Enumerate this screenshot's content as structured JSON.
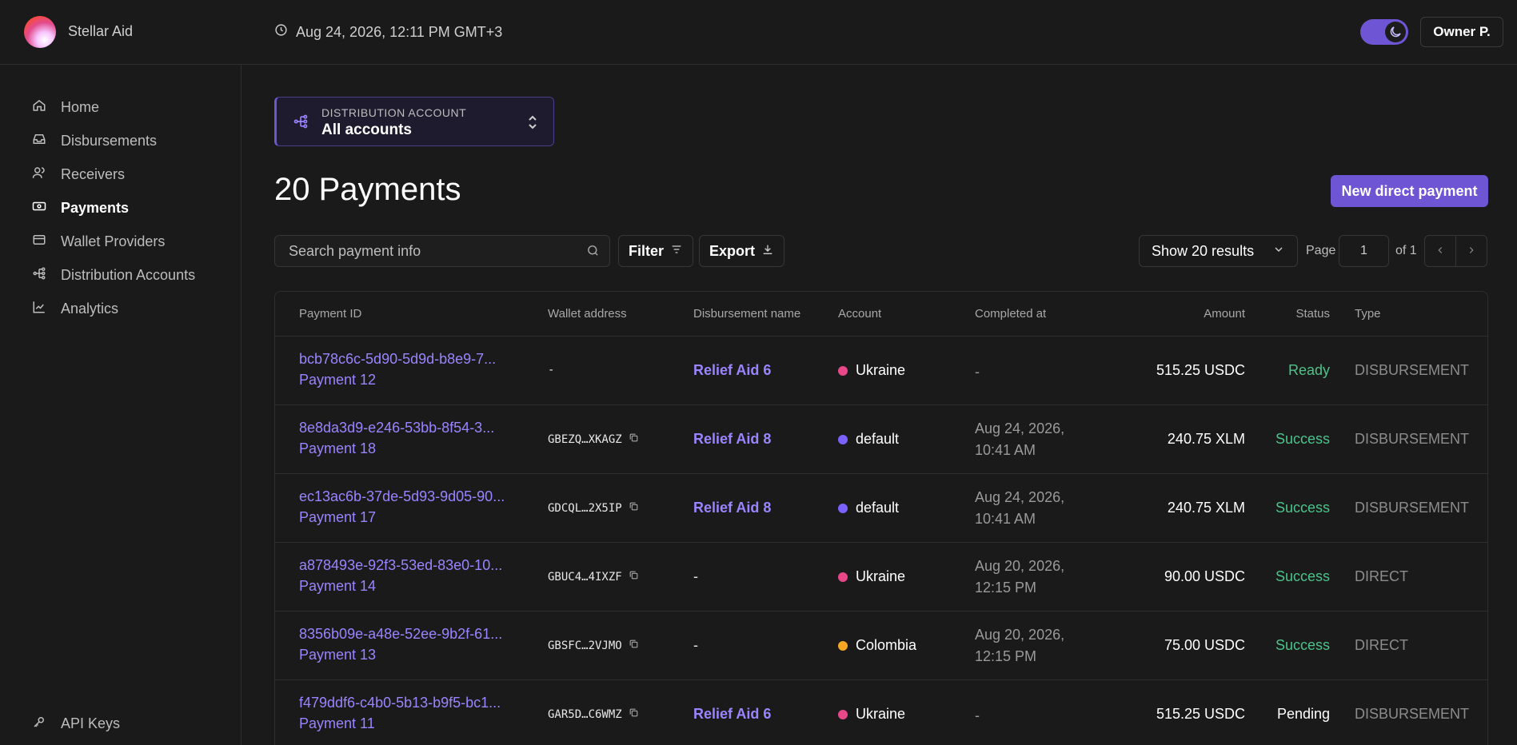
{
  "app": {
    "name": "Stellar Aid"
  },
  "header": {
    "datetime": "Aug 24, 2026, 12:11 PM GMT+3",
    "user_label": "Owner P.",
    "theme_toggle": "dark"
  },
  "sidebar": {
    "items": [
      {
        "label": "Home",
        "icon": "home-icon"
      },
      {
        "label": "Disbursements",
        "icon": "inbox-icon"
      },
      {
        "label": "Receivers",
        "icon": "users-icon"
      },
      {
        "label": "Payments",
        "icon": "banknote-icon",
        "active": true
      },
      {
        "label": "Wallet Providers",
        "icon": "wallet-icon"
      },
      {
        "label": "Distribution Accounts",
        "icon": "network-icon"
      },
      {
        "label": "Analytics",
        "icon": "chart-line-icon"
      }
    ],
    "footer_item": {
      "label": "API Keys",
      "icon": "key-icon"
    }
  },
  "distribution_account": {
    "label": "DISTRIBUTION ACCOUNT",
    "value": "All accounts"
  },
  "page": {
    "title": "20 Payments",
    "new_button": "New direct payment"
  },
  "toolbar": {
    "search_placeholder": "Search payment info",
    "filter_label": "Filter",
    "export_label": "Export",
    "results_label": "Show 20 results",
    "page_label": "Page",
    "page_value": "1",
    "page_of": "of 1"
  },
  "table": {
    "columns": [
      "Payment ID",
      "Wallet address",
      "Disbursement name",
      "Account",
      "Completed at",
      "Amount",
      "Status",
      "Type"
    ],
    "rows": [
      {
        "id": "bcb78c6c-5d90-5d9d-b8e9-7...",
        "name": "Payment 12",
        "wallet": "-",
        "wallet_copy": false,
        "disbursement": "Relief Aid 6",
        "disb_link": true,
        "account": "Ukraine",
        "account_color": "#e8488a",
        "completed_1": "-",
        "completed_2": "",
        "amount": "515.25 USDC",
        "status": "Ready",
        "status_color": "#4cc38a",
        "type": "DISBURSEMENT"
      },
      {
        "id": "8e8da3d9-e246-53bb-8f54-3...",
        "name": "Payment 18",
        "wallet": "GBEZQ…XKAGZ",
        "wallet_copy": true,
        "disbursement": "Relief Aid 8",
        "disb_link": true,
        "account": "default",
        "account_color": "#7b61ff",
        "completed_1": "Aug 24, 2026,",
        "completed_2": "10:41 AM",
        "amount": "240.75 XLM",
        "status": "Success",
        "status_color": "#4cc38a",
        "type": "DISBURSEMENT"
      },
      {
        "id": "ec13ac6b-37de-5d93-9d05-90...",
        "name": "Payment 17",
        "wallet": "GDCQL…2X5IP",
        "wallet_copy": true,
        "disbursement": "Relief Aid 8",
        "disb_link": true,
        "account": "default",
        "account_color": "#7b61ff",
        "completed_1": "Aug 24, 2026,",
        "completed_2": "10:41 AM",
        "amount": "240.75 XLM",
        "status": "Success",
        "status_color": "#4cc38a",
        "type": "DISBURSEMENT"
      },
      {
        "id": "a878493e-92f3-53ed-83e0-10...",
        "name": "Payment 14",
        "wallet": "GBUC4…4IXZF",
        "wallet_copy": true,
        "disbursement": "-",
        "disb_link": false,
        "account": "Ukraine",
        "account_color": "#e8488a",
        "completed_1": "Aug 20, 2026,",
        "completed_2": "12:15 PM",
        "amount": "90.00 USDC",
        "status": "Success",
        "status_color": "#4cc38a",
        "type": "DIRECT"
      },
      {
        "id": "8356b09e-a48e-52ee-9b2f-61...",
        "name": "Payment 13",
        "wallet": "GBSFC…2VJMO",
        "wallet_copy": true,
        "disbursement": "-",
        "disb_link": false,
        "account": "Colombia",
        "account_color": "#f5a623",
        "completed_1": "Aug 20, 2026,",
        "completed_2": "12:15 PM",
        "amount": "75.00 USDC",
        "status": "Success",
        "status_color": "#4cc38a",
        "type": "DIRECT"
      },
      {
        "id": "f479ddf6-c4b0-5b13-b9f5-bc1...",
        "name": "Payment 11",
        "wallet": "GAR5D…C6WMZ",
        "wallet_copy": true,
        "disbursement": "Relief Aid 6",
        "disb_link": true,
        "account": "Ukraine",
        "account_color": "#e8488a",
        "completed_1": "-",
        "completed_2": "",
        "amount": "515.25 USDC",
        "status": "Pending",
        "status_color": "#ffffff",
        "type": "DISBURSEMENT"
      }
    ]
  },
  "colors": {
    "accent": "#6e55d4",
    "link": "#9b84ff",
    "success": "#4cc38a"
  }
}
